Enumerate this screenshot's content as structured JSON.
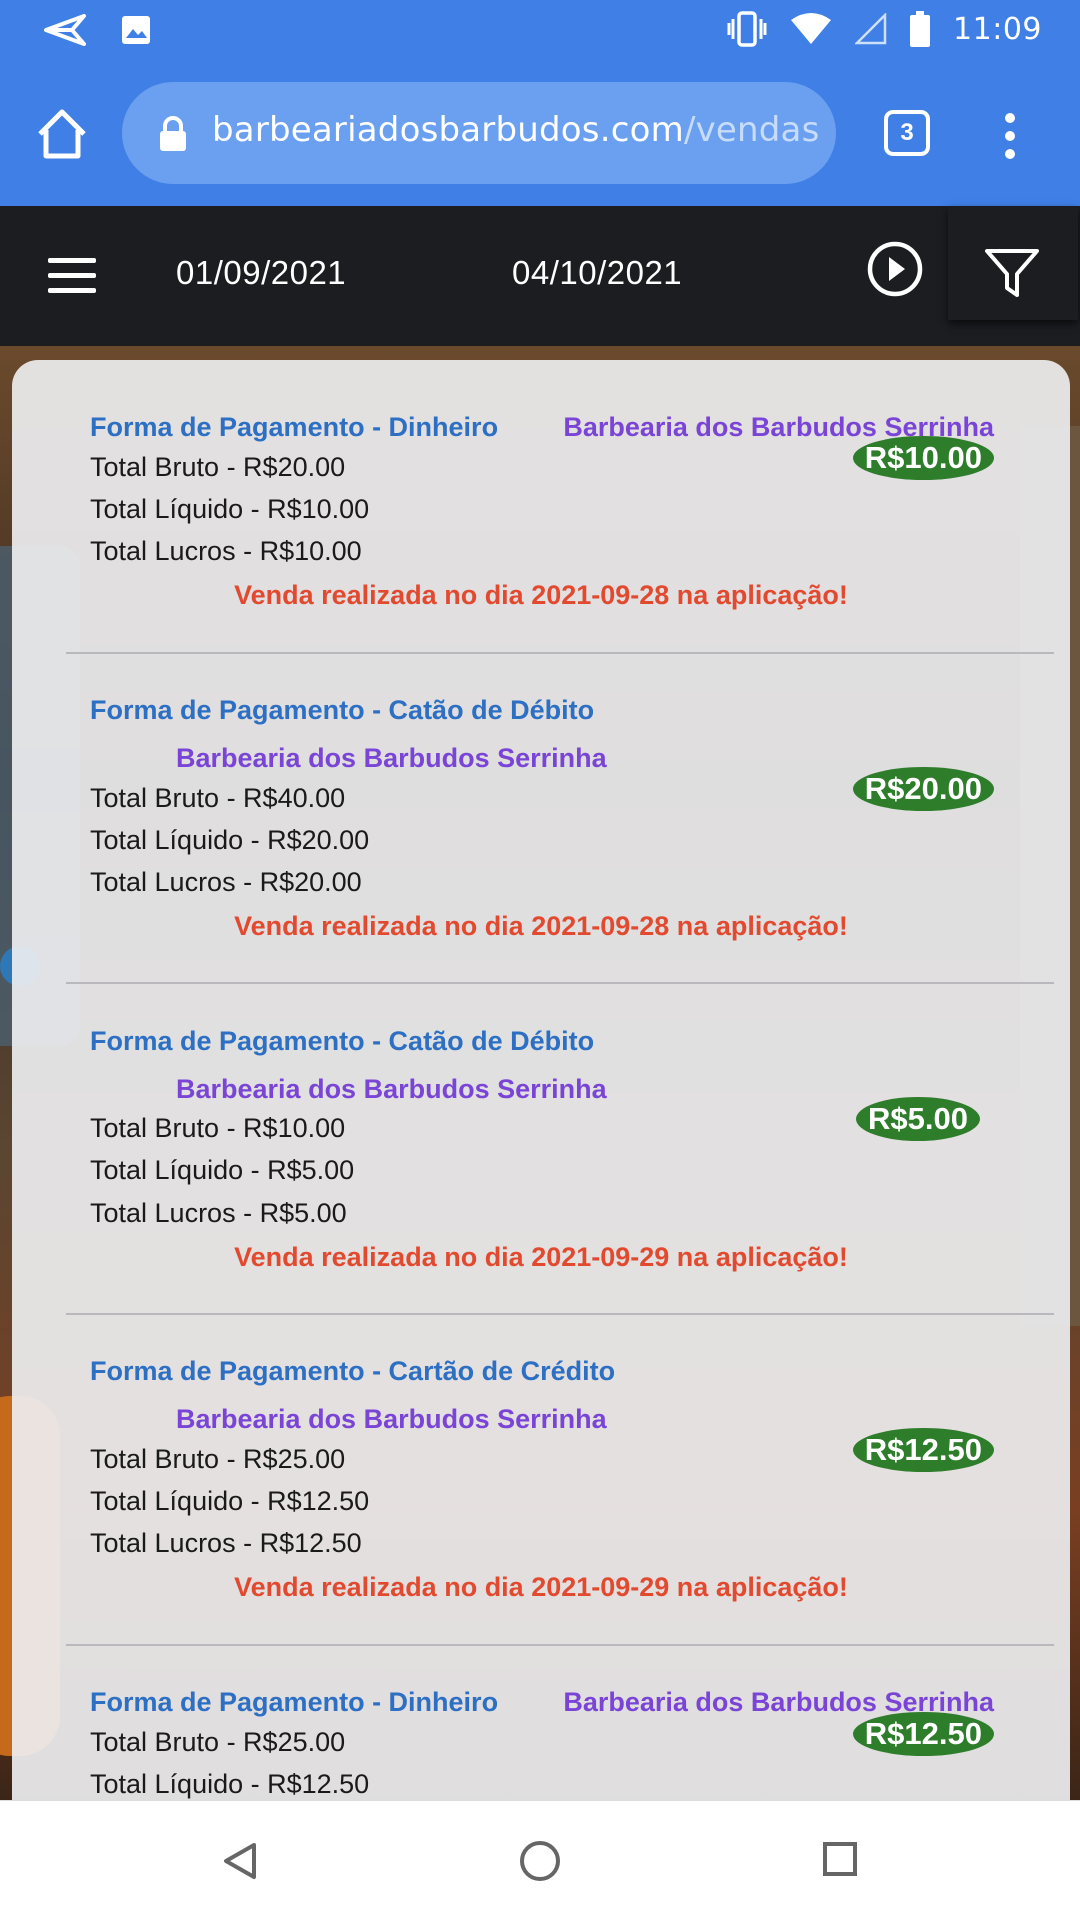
{
  "status_bar": {
    "time": "11:09"
  },
  "browser": {
    "url_domain": "barbeariadosbarbudos.com",
    "url_path": "/vendas",
    "tab_count": "3"
  },
  "header": {
    "date_start": "01/09/2021",
    "date_end": "04/10/2021"
  },
  "entries": [
    {
      "payment": "Forma de Pagamento - Dinheiro",
      "shop": "Barbearia dos Barbudos Serrinha",
      "total_bruto": "Total Bruto - R$20.00",
      "total_liquido": "Total Líquido - R$10.00",
      "total_lucros": "Total Lucros - R$10.00",
      "sale_note": "Venda realizada no dia 2021-09-28 na aplicação!",
      "badge": "R$10.00"
    },
    {
      "payment": "Forma de Pagamento - Catão de Débito",
      "shop": "Barbearia dos Barbudos Serrinha",
      "total_bruto": "Total Bruto - R$40.00",
      "total_liquido": "Total Líquido - R$20.00",
      "total_lucros": "Total Lucros - R$20.00",
      "sale_note": "Venda realizada no dia 2021-09-28 na aplicação!",
      "badge": "R$20.00"
    },
    {
      "payment": "Forma de Pagamento - Catão de Débito",
      "shop": "Barbearia dos Barbudos Serrinha",
      "total_bruto": "Total Bruto - R$10.00",
      "total_liquido": "Total Líquido - R$5.00",
      "total_lucros": "Total Lucros - R$5.00",
      "sale_note": "Venda realizada no dia 2021-09-29 na aplicação!",
      "badge": "R$5.00"
    },
    {
      "payment": "Forma de Pagamento - Cartão de Crédito",
      "shop": "Barbearia dos Barbudos Serrinha",
      "total_bruto": "Total Bruto - R$25.00",
      "total_liquido": "Total Líquido - R$12.50",
      "total_lucros": "Total Lucros - R$12.50",
      "sale_note": "Venda realizada no dia 2021-09-29 na aplicação!",
      "badge": "R$12.50"
    },
    {
      "payment": "Forma de Pagamento - Dinheiro",
      "shop": "Barbearia dos Barbudos Serrinha",
      "total_bruto": "Total Bruto - R$25.00",
      "total_liquido": "Total Líquido - R$12.50",
      "badge": "R$12.50"
    }
  ],
  "colors": {
    "browser_blue": "#3f7fe6",
    "header_dark": "#1c1d21",
    "payment_blue": "#2c6fc3",
    "shop_purple": "#7a45d6",
    "sale_red": "#e24a30",
    "badge_green": "#2e7d2b"
  }
}
